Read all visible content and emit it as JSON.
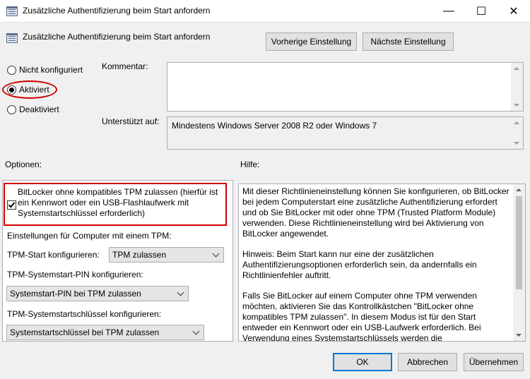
{
  "window": {
    "title": "Zusätzliche Authentifizierung beim Start anfordern",
    "controls": {
      "minimize": "—",
      "maximize": "☐",
      "close": "✕"
    }
  },
  "header": {
    "policy_title": "Zusätzliche Authentifizierung beim Start anfordern",
    "prev_button": "Vorherige Einstellung",
    "next_button": "Nächste Einstellung"
  },
  "state": {
    "options": [
      {
        "label": "Nicht konfiguriert",
        "selected": false
      },
      {
        "label": "Aktiviert",
        "selected": true
      },
      {
        "label": "Deaktiviert",
        "selected": false
      }
    ]
  },
  "comment": {
    "label": "Kommentar:",
    "value": ""
  },
  "supported": {
    "label": "Unterstützt auf:",
    "value": "Mindestens Windows Server 2008 R2 oder Windows 7"
  },
  "options_panel": {
    "label": "Optionen:",
    "bitlocker_checkbox": {
      "label_line1": "BitLocker ohne kompatibles TPM zulassen (hierfür ist",
      "label_line2": "ein Kennwort oder ein USB-Flashlaufwerk mit",
      "label_line3": "Systemstartschlüssel erforderlich)",
      "checked": true
    },
    "tpm_section_label": "Einstellungen für Computer mit einem TPM:",
    "tpm_start_label": "TPM-Start konfigurieren:",
    "tpm_start_value": "TPM zulassen",
    "tpm_pin_label": "TPM-Systemstart-PIN konfigurieren:",
    "tpm_pin_value": "Systemstart-PIN bei TPM zulassen",
    "tpm_key_label": "TPM-Systemstartschlüssel konfigurieren:",
    "tpm_key_value": "Systemstartschlüssel bei TPM zulassen"
  },
  "help_panel": {
    "label": "Hilfe:",
    "paragraphs": [
      "Mit dieser Richtlinieneinstellung können Sie konfigurieren, ob BitLocker bei jedem Computerstart eine zusätzliche Authentifizierung erfordert und ob Sie BitLocker mit oder ohne TPM (Trusted Platform Module) verwenden. Diese Richtlinieneinstellung wird bei Aktivierung von BitLocker angewendet.",
      "Hinweis: Beim Start kann nur eine der zusätzlichen Authentifizierungsoptionen erforderlich sein, da andernfalls ein Richtlinienfehler auftritt.",
      "Falls Sie BitLocker auf einem Computer ohne TPM verwenden möchten, aktivieren Sie das Kontrollkästchen \"BitLocker ohne kompatibles TPM zulassen\". In diesem Modus ist für den Start entweder ein Kennwort oder ein USB-Laufwerk erforderlich. Bei Verwendung eines Systemstartschlüssels werden die Schlüsselinformationen, die zum"
    ]
  },
  "footer": {
    "ok": "OK",
    "cancel": "Abbrechen",
    "apply": "Übernehmen"
  }
}
